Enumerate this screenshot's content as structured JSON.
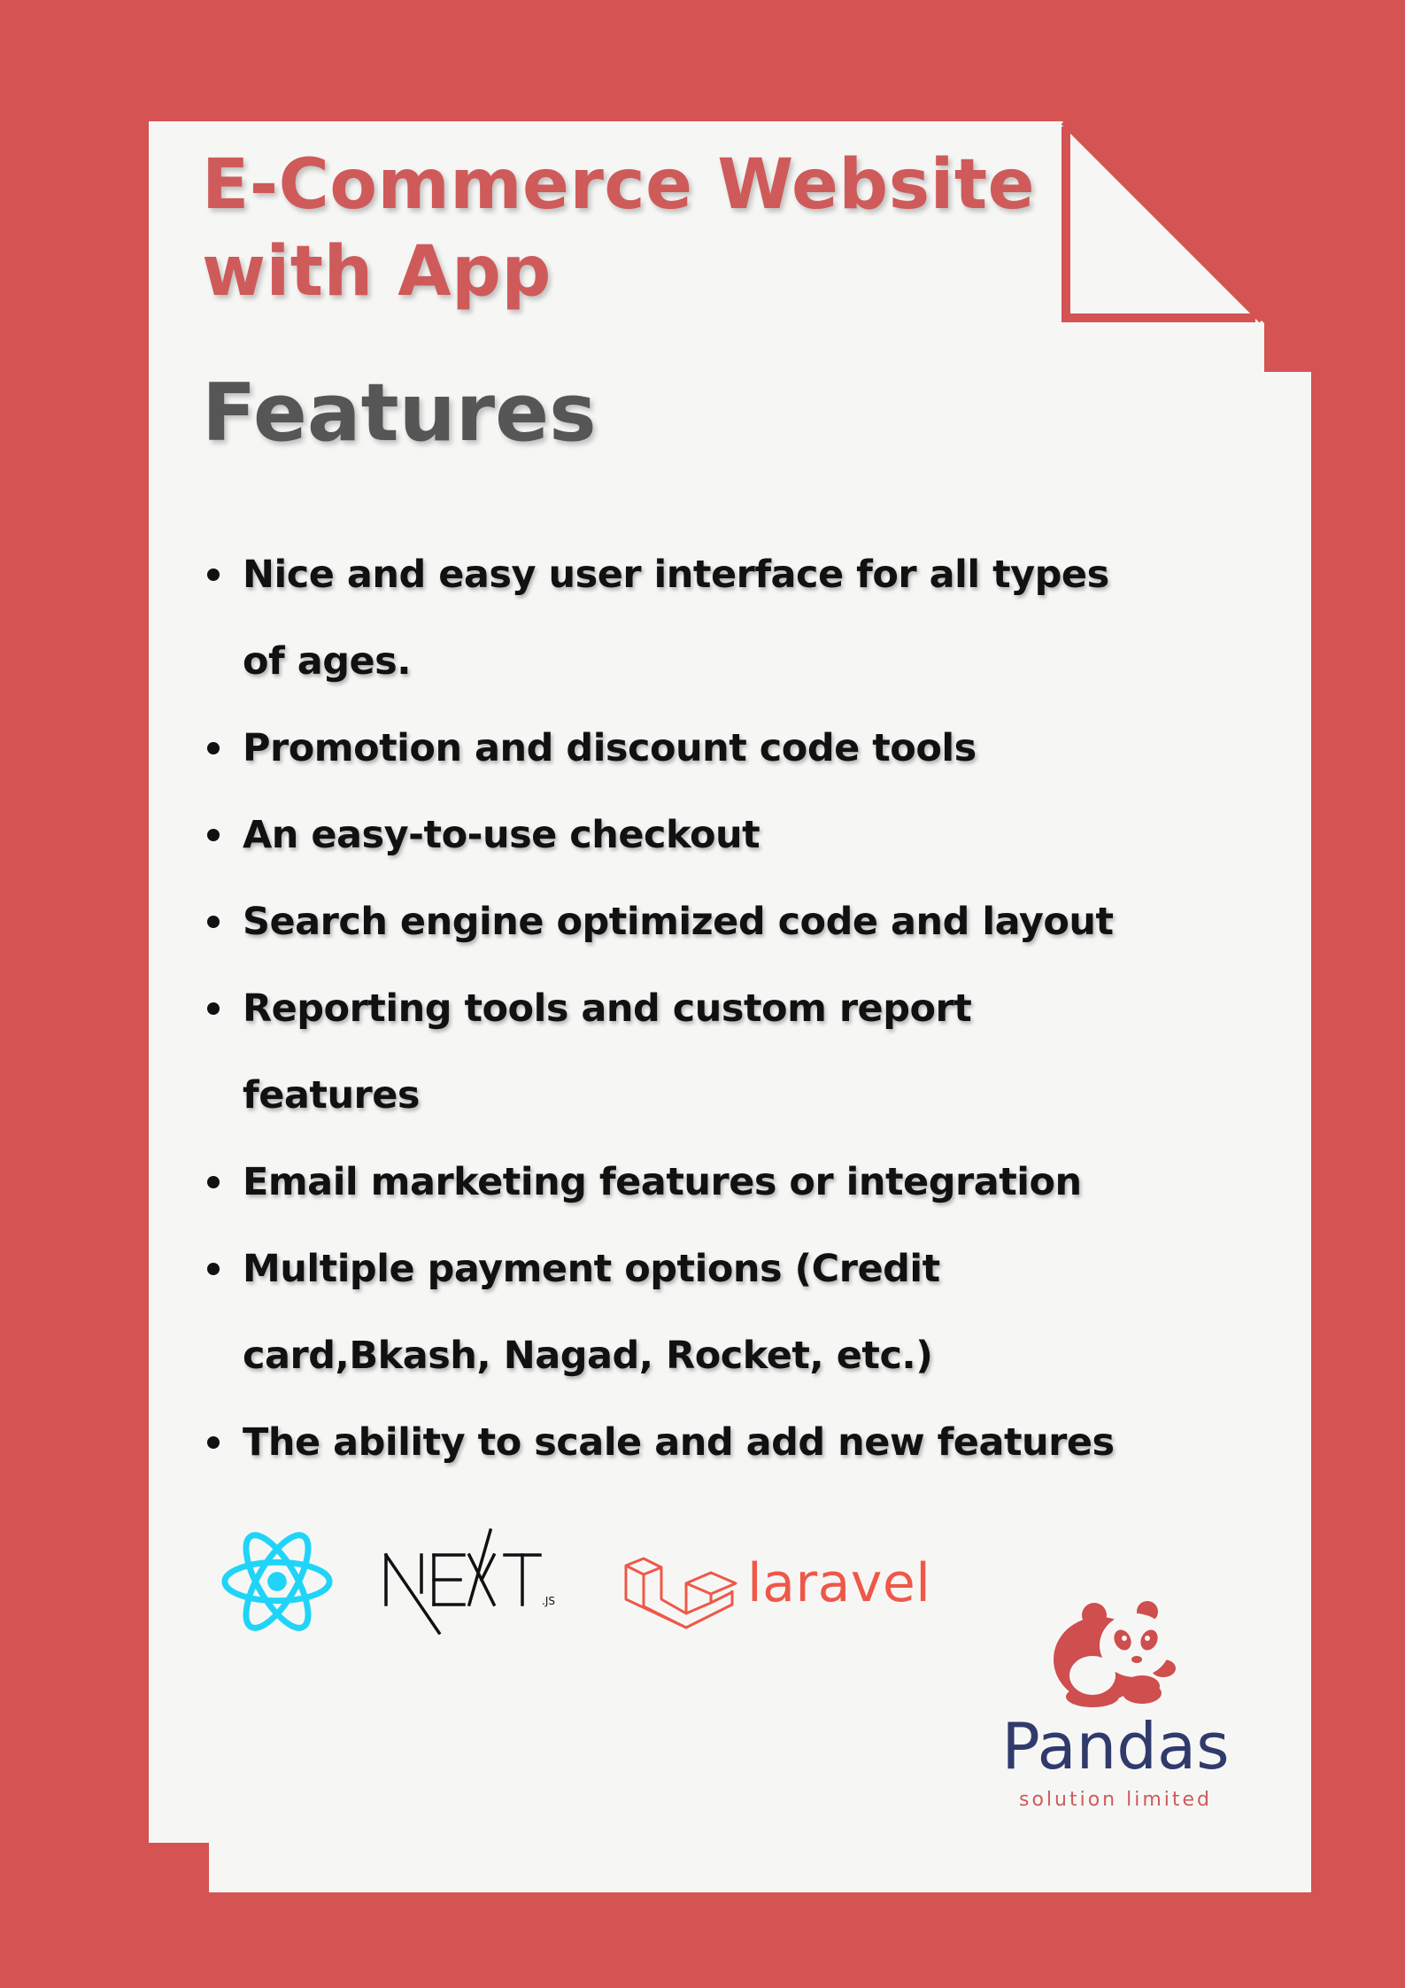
{
  "document": {
    "title": "E-Commerce Website with App",
    "section_heading": "Features",
    "features": [
      "Nice and easy user interface for all types of ages.",
      "Promotion and discount code tools",
      "An easy-to-use checkout",
      "Search engine optimized code and layout",
      "Reporting tools and custom report features",
      "Email marketing features or integration",
      "Multiple payment options (Credit card,Bkash, Nagad, Rocket, etc.)",
      "The ability to scale and add new features"
    ]
  },
  "tech_logos": {
    "next_sub": ".JS",
    "laravel_word": "laravel",
    "icons": [
      "react-icon",
      "nextjs-icon",
      "laravel-icon"
    ]
  },
  "brand": {
    "name": "Pandas",
    "subtitle": "solution limited",
    "icon": "panda-icon"
  },
  "colors": {
    "background": "#d55353",
    "paper": "#f6f7f5",
    "title": "#cf5a5a",
    "heading": "#565656",
    "react": "#20d4f8",
    "laravel": "#ef5848",
    "brand_name": "#303a6b"
  }
}
